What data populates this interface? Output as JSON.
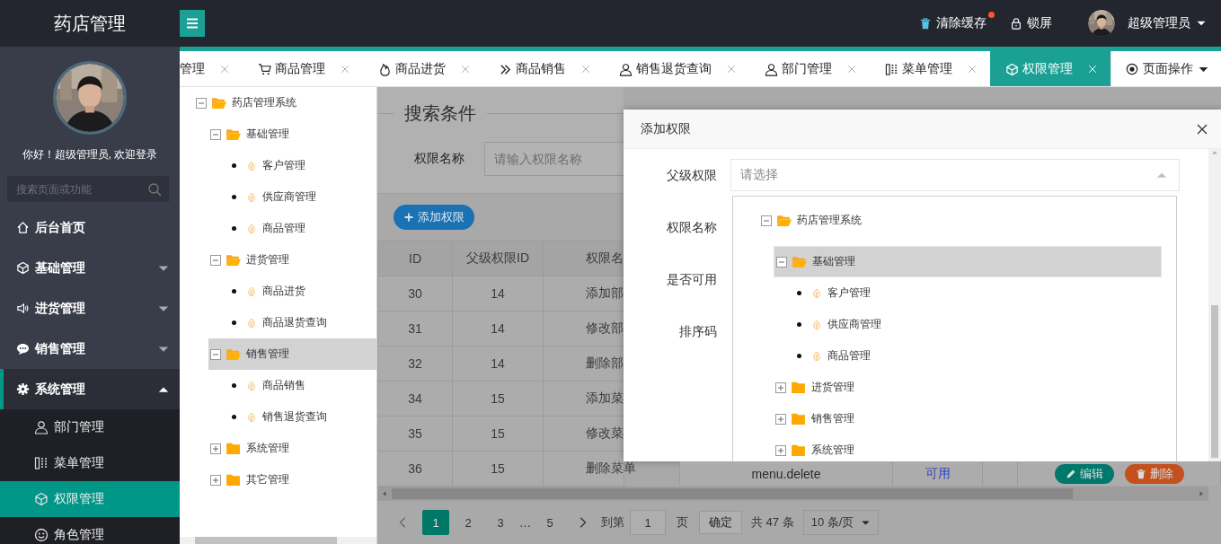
{
  "header": {
    "logo": "药店管理",
    "actions": [
      {
        "label": "清除缓存",
        "badge": true
      },
      {
        "label": "锁屏",
        "badge": false
      }
    ],
    "user": {
      "name": "超级管理员"
    }
  },
  "sidebar": {
    "greeting": "你好！超级管理员, 欢迎登录",
    "search": {
      "placeholder": "搜索页面或功能"
    },
    "items": [
      {
        "label": "后台首页",
        "kind": "link",
        "selected": false
      },
      {
        "label": "基础管理",
        "kind": "group",
        "expanded": false,
        "selected": false
      },
      {
        "label": "进货管理",
        "kind": "group",
        "expanded": false,
        "selected": false
      },
      {
        "label": "销售管理",
        "kind": "group",
        "expanded": false,
        "selected": false
      },
      {
        "label": "系统管理",
        "kind": "group",
        "expanded": true,
        "selected": false,
        "children": [
          {
            "label": "部门管理",
            "selected": false
          },
          {
            "label": "菜单管理",
            "selected": false
          },
          {
            "label": "权限管理",
            "selected": true
          },
          {
            "label": "角色管理",
            "selected": false
          }
        ]
      }
    ]
  },
  "tabs": [
    {
      "label": "管理",
      "selected": false
    },
    {
      "label": "商品管理",
      "selected": false
    },
    {
      "label": "商品进货",
      "selected": false
    },
    {
      "label": "商品销售",
      "selected": false
    },
    {
      "label": "销售退货查询",
      "selected": false
    },
    {
      "label": "部门管理",
      "selected": false
    },
    {
      "label": "菜单管理",
      "selected": false
    },
    {
      "label": "权限管理",
      "selected": true
    }
  ],
  "page_actions": {
    "label": "页面操作"
  },
  "left_tree": [
    {
      "label": "药店管理系统",
      "kind": "folder",
      "expanded": true,
      "selected": false,
      "children": [
        {
          "label": "基础管理",
          "kind": "folder",
          "expanded": true,
          "selected": false,
          "children": [
            {
              "label": "客户管理",
              "kind": "leaf",
              "selected": false
            },
            {
              "label": "供应商管理",
              "kind": "leaf",
              "selected": false
            },
            {
              "label": "商品管理",
              "kind": "leaf",
              "selected": false
            }
          ]
        },
        {
          "label": "进货管理",
          "kind": "folder",
          "expanded": true,
          "selected": false,
          "children": [
            {
              "label": "商品进货",
              "kind": "leaf",
              "selected": false
            },
            {
              "label": "商品退货查询",
              "kind": "leaf",
              "selected": false
            }
          ]
        },
        {
          "label": "销售管理",
          "kind": "folder",
          "expanded": true,
          "selected": true,
          "children": [
            {
              "label": "商品销售",
              "kind": "leaf",
              "selected": false
            },
            {
              "label": "销售退货查询",
              "kind": "leaf",
              "selected": false
            }
          ]
        },
        {
          "label": "系统管理",
          "kind": "folder",
          "expanded": false,
          "selected": false
        },
        {
          "label": "其它管理",
          "kind": "folder",
          "expanded": false,
          "selected": false
        }
      ]
    }
  ],
  "search": {
    "legend": "搜索条件",
    "field": {
      "label": "权限名称",
      "placeholder": "请输入权限名称"
    }
  },
  "toolbar": {
    "add_button": "添加权限"
  },
  "table": {
    "columns": [
      "ID",
      "父级权限ID",
      "权限名"
    ],
    "rows": [
      [
        "30",
        "14",
        "添加部"
      ],
      [
        "31",
        "14",
        "修改部"
      ],
      [
        "32",
        "14",
        "删除部"
      ],
      [
        "34",
        "15",
        "添加菜"
      ],
      [
        "35",
        "15",
        "修改菜"
      ],
      [
        "36",
        "15",
        "删除菜单"
      ]
    ],
    "last_row_rest": {
      "code": "menu.delete",
      "status": "可用",
      "edit_button": "编辑",
      "delete_button": "删除"
    }
  },
  "pagination": {
    "pages": [
      {
        "label": "1",
        "kind": "page",
        "selected": true
      },
      {
        "label": "2",
        "kind": "page",
        "selected": false
      },
      {
        "label": "3",
        "kind": "page",
        "selected": false
      },
      {
        "label": "…",
        "kind": "ellipsis"
      },
      {
        "label": "5",
        "kind": "page",
        "selected": false
      }
    ],
    "goto_label": "到第",
    "goto_value": "1",
    "page_unit": "页",
    "confirm": "确定",
    "total": "共 47 条",
    "page_size": "10 条/页"
  },
  "modal": {
    "title": "添加权限",
    "fields": [
      {
        "label": "父级权限",
        "kind": "select",
        "placeholder": "请选择",
        "open": true
      },
      {
        "label": "权限名称",
        "kind": "text"
      },
      {
        "label": "是否可用",
        "kind": "text"
      },
      {
        "label": "排序码",
        "kind": "text"
      }
    ],
    "parent_tree": [
      {
        "label": "药店管理系统",
        "kind": "folder",
        "expanded": true,
        "selected": false,
        "children": [
          {
            "label": "基础管理",
            "kind": "folder",
            "expanded": true,
            "selected": true,
            "children": [
              {
                "label": "客户管理",
                "kind": "leaf",
                "selected": false
              },
              {
                "label": "供应商管理",
                "kind": "leaf",
                "selected": false
              },
              {
                "label": "商品管理",
                "kind": "leaf",
                "selected": false
              }
            ]
          },
          {
            "label": "进货管理",
            "kind": "folder",
            "expanded": false,
            "selected": false
          },
          {
            "label": "销售管理",
            "kind": "folder",
            "expanded": false,
            "selected": false
          },
          {
            "label": "系统管理",
            "kind": "folder",
            "expanded": false,
            "selected": false
          }
        ]
      }
    ]
  }
}
